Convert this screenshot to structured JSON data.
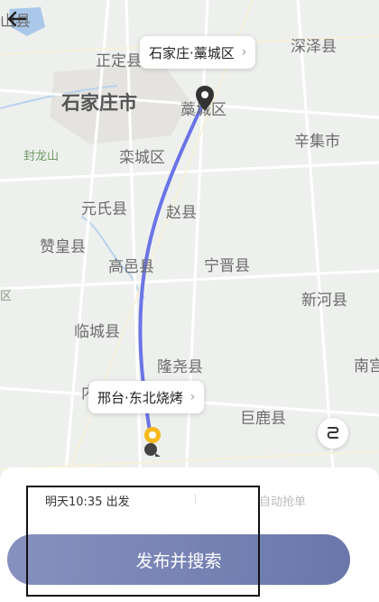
{
  "map": {
    "labels": {
      "shijiazhuang": "石家庄市",
      "zhengding": "正定县",
      "shenze": "深泽县",
      "xinji": "辛集市",
      "luancheng": "栾城区",
      "yuanshi": "元氏县",
      "zhaoxian": "赵县",
      "zanhuang": "赞皇县",
      "gaoyi": "高邑县",
      "ningjin": "宁晋县",
      "xinhe": "新河县",
      "lincheng": "临城县",
      "longyao": "隆尧县",
      "julu": "巨鹿县",
      "nangong": "南宫",
      "fenglongshan": "封龙山",
      "gaocheng_under": "藁城区",
      "edge_top": "山县",
      "edge_mid": "区",
      "neiqiu": "内"
    }
  },
  "origin_bubble": "石家庄·藁城区",
  "dest_bubble": "邢台·东北烧烤",
  "chevron": "›",
  "panel": {
    "depart_time": "明天10:35 出发",
    "auto_grab": "自动抢单",
    "publish_button": "发布并搜索"
  },
  "colors": {
    "route": "#6b74e6",
    "button": "#7581b5",
    "origin_pin": "#333333",
    "dest_pin": "#f6b81a"
  },
  "icons": {
    "back": "arrow-left-icon",
    "swap": "swap-route-icon",
    "origin": "origin-pin-icon",
    "destination": "destination-pin-icon"
  }
}
